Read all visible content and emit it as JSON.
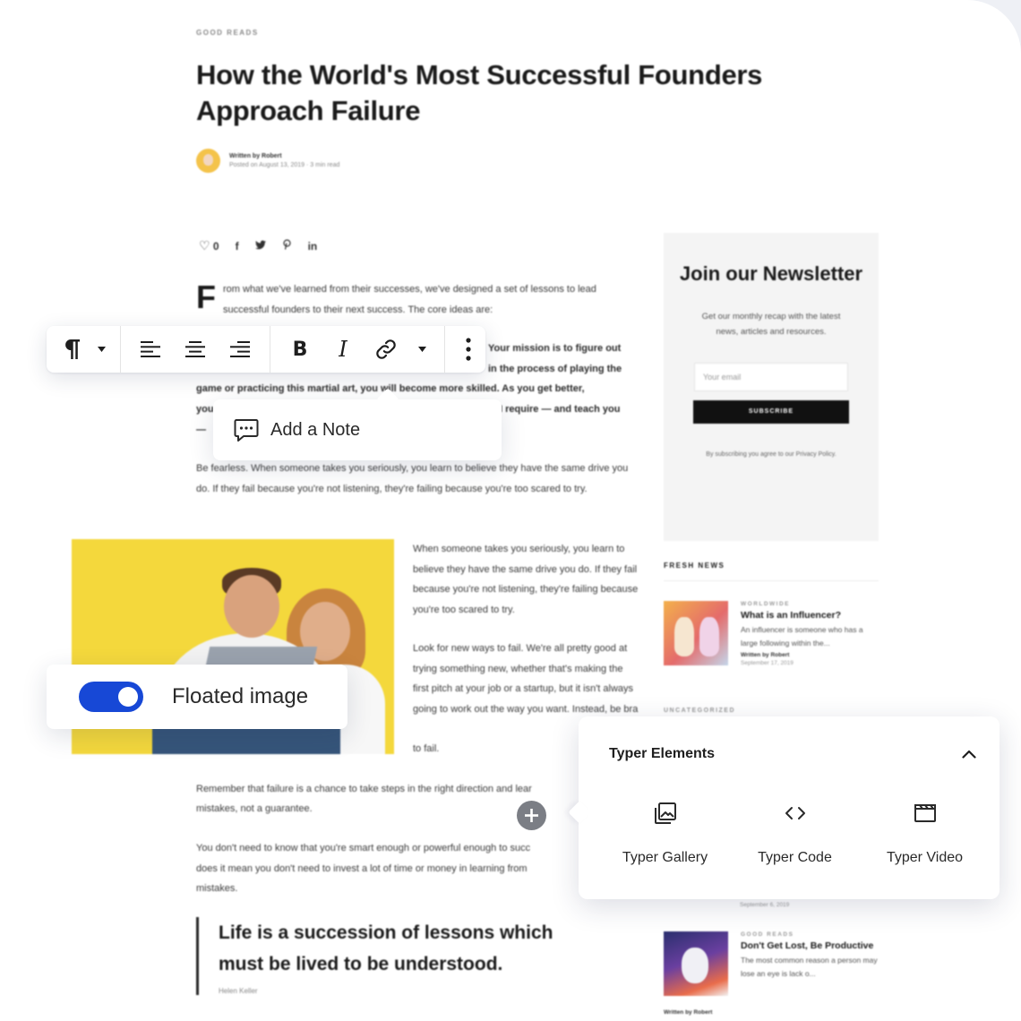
{
  "article": {
    "category": "GOOD READS",
    "title": "How the World's Most Successful Founders Approach Failure",
    "author_line": "Written by Robert",
    "meta_line": "Posted on August 13, 2019 · 3 min read",
    "like_count": "0",
    "dropcap": "F",
    "intro": "rom what we've learned from their successes, we've designed a set of lessons to lead successful founders to their next success. The core ideas are:",
    "bold_paragraph_fragment_1": "Your mission is to figure out",
    "bold_paragraph_fragment_2": "in the process of playing the",
    "bold_paragraph_line_3": "game or practicing this martial art, you will become more skilled. As you get better,",
    "bold_paragraph_fragment_4_start": "you",
    "bold_paragraph_fragment_4_end": "I require — and teach you",
    "bold_paragraph_fragment_5_start": "—",
    "fearless_paragraph": "Be fearless. When someone takes you seriously, you learn to believe they have the same drive you do. If they fail because you're not listening, they're failing because you're too scared to try.",
    "side_para_1": "When someone takes you seriously, you learn to believe they have the same drive you do. If they fail because you're not listening, they're failing because you're too scared to try.",
    "side_para_2": "Look for new ways to fail. We're all pretty good at trying something new, whether that's making the first pitch at your job or a startup, but it isn't always going to work out the way you want. Instead, be bra",
    "side_para_2_end": "to fail.",
    "remember_para": "Remember that failure is a chance to take steps in the right direction and lear",
    "remember_para_2": "mistakes, not a guarantee.",
    "smart_para": "You don't need to know that you're smart enough or powerful enough to succ",
    "smart_para_2": "does it mean you don't need to invest a lot of time or money in learning from",
    "smart_para_3": "mistakes.",
    "quote": "Life is a succession of lessons which must be lived to be understood.",
    "quote_cite": "Helen Keller"
  },
  "newsletter": {
    "title": "Join our Newsletter",
    "description": "Get our monthly recap with the latest news, articles and resources.",
    "email_placeholder": "Your email",
    "subscribe_label": "SUBSCRIBE",
    "note": "By subscribing you agree to our Privacy Policy."
  },
  "fresh_news": {
    "heading": "FRESH NEWS",
    "items": [
      {
        "category": "WORLDWIDE",
        "title": "What is an Influencer?",
        "excerpt": "An influencer is someone who has a large following within the...",
        "author": "Written by Robert",
        "date": "September 17, 2019"
      },
      {
        "category": "GOOD READS",
        "title": "Don't Get Lost, Be Productive",
        "excerpt": "The most common reason a person may lose an eye is lack o...",
        "author": "Written by Robert",
        "date": "September 6, 2019"
      }
    ],
    "uncategorized_label": "UNCATEGORIZED"
  },
  "toolbar": {
    "paragraph_icon": "pilcrow-icon",
    "align_left_icon": "align-left-icon",
    "align_center_icon": "align-center-icon",
    "align_right_icon": "align-right-icon",
    "bold_label": "B",
    "italic_label": "I",
    "link_icon": "link-icon",
    "more_icon": "vertical-ellipsis-icon"
  },
  "note_popup": {
    "label": "Add a Note",
    "icon": "comment-dots-icon"
  },
  "floated_image": {
    "label": "Floated image",
    "enabled": true,
    "toggle_color": "#1748d6"
  },
  "typer_elements": {
    "heading": "Typer Elements",
    "items": [
      {
        "label": "Typer Gallery",
        "icon": "gallery-icon"
      },
      {
        "label": "Typer Code",
        "icon": "code-icon"
      },
      {
        "label": "Typer Video",
        "icon": "clapperboard-icon"
      }
    ]
  }
}
